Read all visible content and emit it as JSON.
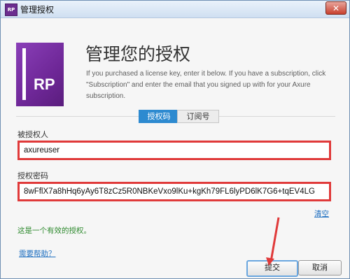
{
  "window": {
    "title": "管理授权",
    "close_label": "✕"
  },
  "header": {
    "logo_text": "RP",
    "title": "管理您的授权",
    "description": "If you purchased a license key, enter it below. If you have a subscription, click \"Subscription\" and enter the email that you signed up with for your Axure subscription."
  },
  "tabs": [
    {
      "label": "授权码",
      "active": true
    },
    {
      "label": "订阅号",
      "active": false
    }
  ],
  "form": {
    "licensee_label": "被授权人",
    "licensee_value": "axureuser",
    "key_label": "授权密码",
    "key_value": "8wFflX7a8hHq6yAy6T8zCz5R0NBKeVxo9lKu+kgKh79FL6lyPD6lK7G6+tqEV4LG",
    "clear_label": "清空"
  },
  "status": {
    "valid_message": "这是一个有效的授权。"
  },
  "footer": {
    "help_label": "需要帮助？",
    "submit_label": "提交",
    "cancel_label": "取消"
  },
  "colors": {
    "accent": "#2d8ad0",
    "highlight_red": "#e03a3a",
    "logo_purple": "#6e2797",
    "valid_green": "#2f8a2f"
  }
}
